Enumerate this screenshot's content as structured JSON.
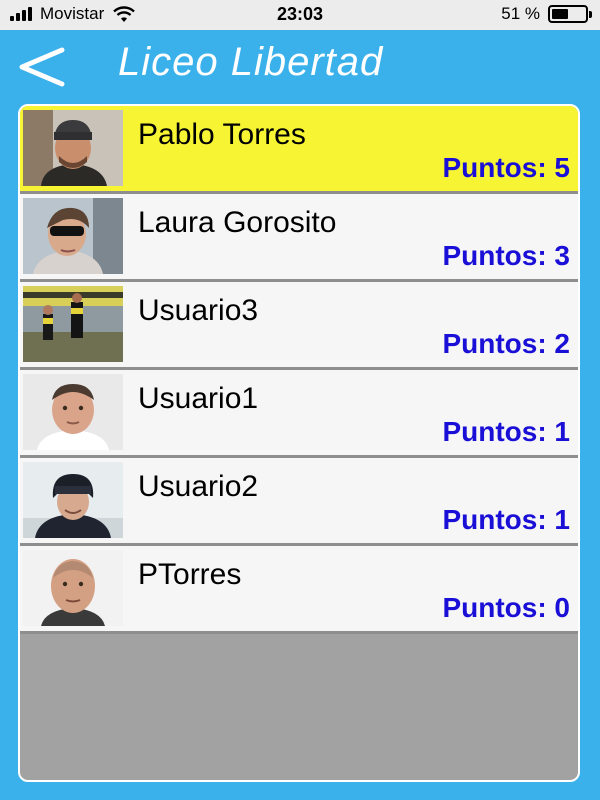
{
  "status_bar": {
    "carrier": "Movistar",
    "time": "23:03",
    "battery": "51 %",
    "battery_level": 0.51
  },
  "nav": {
    "back_label": "<",
    "title": "Liceo Libertad"
  },
  "students": [
    {
      "name": "Pablo Torres",
      "points": "Puntos: 5",
      "selected": true,
      "avatar": "photo-man-beanie"
    },
    {
      "name": "Laura Gorosito",
      "points": "Puntos: 3",
      "selected": false,
      "avatar": "photo-woman-sunglasses"
    },
    {
      "name": "Usuario3",
      "points": "Puntos: 2",
      "selected": false,
      "avatar": "photo-stadium-fans"
    },
    {
      "name": "Usuario1",
      "points": "Puntos: 1",
      "selected": false,
      "avatar": "photo-man-portrait"
    },
    {
      "name": "Usuario2",
      "points": "Puntos: 1",
      "selected": false,
      "avatar": "photo-man-fur-hat"
    },
    {
      "name": "PTorres",
      "points": "Puntos: 0",
      "selected": false,
      "avatar": "photo-man-bald"
    }
  ],
  "colors": {
    "background": "#3bb1ec",
    "selected_row": "#f7f533",
    "points_text": "#1a0fd6",
    "list_empty": "#a2a2a2"
  }
}
